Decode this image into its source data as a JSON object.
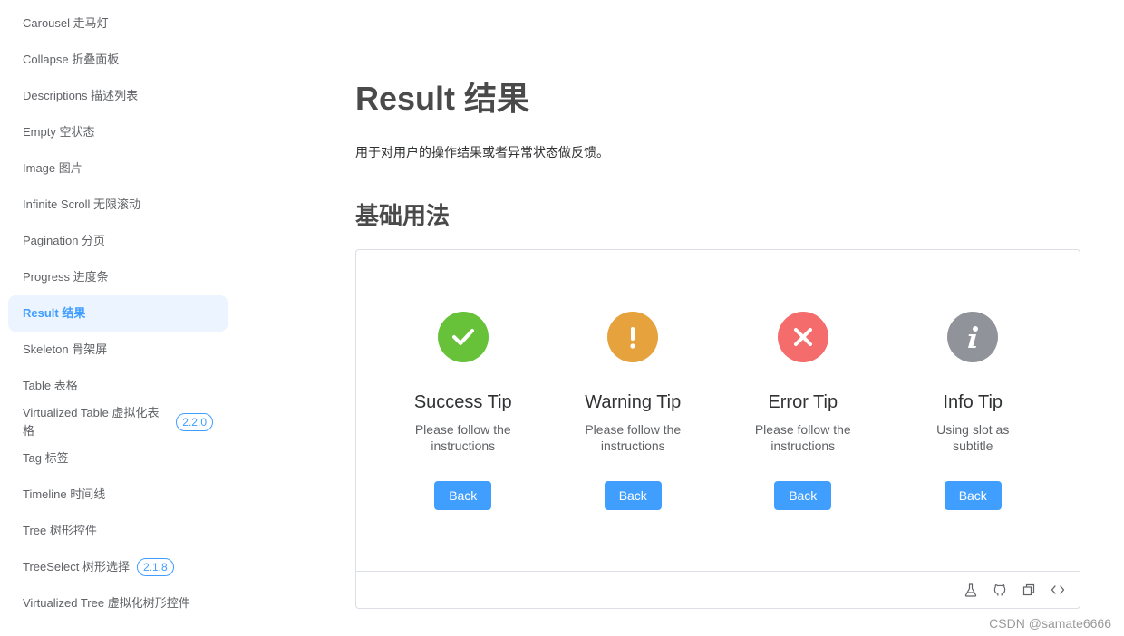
{
  "sidebar": {
    "items": [
      {
        "label": "Carousel 走马灯"
      },
      {
        "label": "Collapse 折叠面板"
      },
      {
        "label": "Descriptions 描述列表"
      },
      {
        "label": "Empty 空状态"
      },
      {
        "label": "Image 图片"
      },
      {
        "label": "Infinite Scroll 无限滚动"
      },
      {
        "label": "Pagination 分页"
      },
      {
        "label": "Progress 进度条"
      },
      {
        "label": "Result 结果",
        "active": true
      },
      {
        "label": "Skeleton 骨架屏"
      },
      {
        "label": "Table 表格"
      },
      {
        "label": "Virtualized Table 虚拟化表格",
        "badge": "2.2.0"
      },
      {
        "label": "Tag 标签"
      },
      {
        "label": "Timeline 时间线"
      },
      {
        "label": "Tree 树形控件"
      },
      {
        "label": "TreeSelect 树形选择",
        "badge": "2.1.8"
      },
      {
        "label": "Virtualized Tree 虚拟化树形控件"
      }
    ]
  },
  "main": {
    "title": "Result 结果",
    "description": "用于对用户的操作结果或者异常状态做反馈。",
    "section_title": "基础用法",
    "results": [
      {
        "type": "success",
        "icon": "check-icon",
        "title": "Success Tip",
        "subtitle": "Please follow the instructions",
        "button": "Back"
      },
      {
        "type": "warning",
        "icon": "exclamation-icon",
        "title": "Warning Tip",
        "subtitle": "Please follow the instructions",
        "button": "Back"
      },
      {
        "type": "error",
        "icon": "close-icon",
        "title": "Error Tip",
        "subtitle": "Please follow the instructions",
        "button": "Back"
      },
      {
        "type": "info",
        "icon": "info-icon",
        "title": "Info Tip",
        "subtitle": "Using slot as subtitle",
        "button": "Back"
      }
    ],
    "toolbar_icons": [
      "flask-icon",
      "github-icon",
      "copy-icon",
      "code-icon"
    ]
  },
  "colors": {
    "success": "#67c23a",
    "warning": "#e6a23c",
    "error": "#f56c6c",
    "info": "#909399",
    "primary": "#409eff"
  },
  "watermark": "CSDN @samate6666"
}
